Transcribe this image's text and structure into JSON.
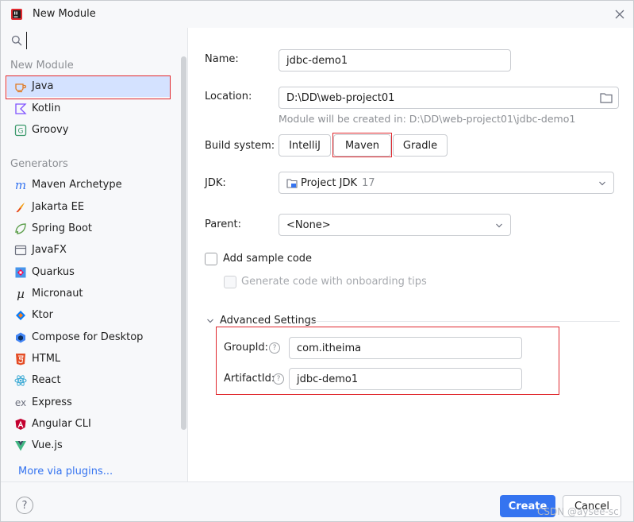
{
  "window": {
    "title": "New Module"
  },
  "sidebar": {
    "search_value": "",
    "section_new_module": "New Module",
    "section_generators": "Generators",
    "new_module_items": [
      {
        "label": "Java",
        "icon": "java-cup-icon"
      },
      {
        "label": "Kotlin",
        "icon": "kotlin-icon"
      },
      {
        "label": "Groovy",
        "icon": "groovy-icon"
      }
    ],
    "generator_items": [
      {
        "label": "Maven Archetype",
        "icon": "maven-icon"
      },
      {
        "label": "Jakarta EE",
        "icon": "jakarta-icon"
      },
      {
        "label": "Spring Boot",
        "icon": "spring-icon"
      },
      {
        "label": "JavaFX",
        "icon": "javafx-icon"
      },
      {
        "label": "Quarkus",
        "icon": "quarkus-icon"
      },
      {
        "label": "Micronaut",
        "icon": "micronaut-icon"
      },
      {
        "label": "Ktor",
        "icon": "ktor-icon"
      },
      {
        "label": "Compose for Desktop",
        "icon": "compose-icon"
      },
      {
        "label": "HTML",
        "icon": "html5-icon"
      },
      {
        "label": "React",
        "icon": "react-icon"
      },
      {
        "label": "Express",
        "icon": "express-icon"
      },
      {
        "label": "Angular CLI",
        "icon": "angular-icon"
      },
      {
        "label": "Vue.js",
        "icon": "vue-icon"
      }
    ],
    "more_plugins": "More via plugins..."
  },
  "form": {
    "name_label": "Name:",
    "name_value": "jdbc-demo1",
    "location_label": "Location:",
    "location_value": "D:\\DD\\web-project01",
    "location_hint": "Module will be created in: D:\\DD\\web-project01\\jdbc-demo1",
    "build_label": "Build system:",
    "build_options": [
      "IntelliJ",
      "Maven",
      "Gradle"
    ],
    "build_selected": "Maven",
    "jdk_label": "JDK:",
    "jdk_value": "Project JDK",
    "jdk_version": "17",
    "parent_label": "Parent:",
    "parent_value": "<None>",
    "sample_code_label": "Add sample code",
    "onboarding_label": "Generate code with onboarding tips",
    "advanced_label": "Advanced Settings",
    "groupid_label": "GroupId:",
    "groupid_value": "com.itheima",
    "artifactid_label": "ArtifactId:",
    "artifactid_value": "jdbc-demo1"
  },
  "footer": {
    "help": "?",
    "create": "Create",
    "cancel": "Cancel",
    "watermark": "CSDN @aysee-sc"
  },
  "colors": {
    "accent": "#3574f0",
    "highlight": "#e0282e",
    "selection": "#d4e2ff"
  }
}
